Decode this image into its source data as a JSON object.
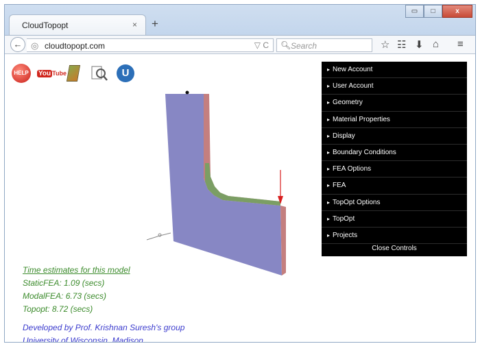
{
  "browser": {
    "tab_title": "CloudTopopt",
    "tab_close": "×",
    "new_tab": "+",
    "url": "cloudtopopt.com",
    "search_placeholder": "Search",
    "window_buttons": [
      "▭",
      "□",
      "x"
    ]
  },
  "toolbar_icons": [
    "help-icon",
    "youtube-icon",
    "book-icon",
    "magnifier-icon",
    "u-icon"
  ],
  "help_text": "HELP",
  "youtube_text": "You",
  "youtube_tube": "Tube",
  "u_text": "U",
  "menu": {
    "items": [
      "New Account",
      "User Account",
      "Geometry",
      "Material Properties",
      "Display",
      "Boundary Conditions",
      "FEA Options",
      "FEA",
      "TopOpt Options",
      "TopOpt",
      "Projects"
    ],
    "close_label": "Close Controls"
  },
  "estimates": {
    "heading": "Time estimates for this model",
    "static": "StaticFEA: 1.09 (secs)",
    "modal": "ModalFEA: 6.73 (secs)",
    "topopt": "Topopt: 8.72 (secs)"
  },
  "credits": {
    "line1": "Developed by Prof. Krishnan Suresh's group",
    "line2": "University of Wisconsin, Madison"
  },
  "colors": {
    "part_face": "#8787c4",
    "part_side": "#c47f7f",
    "part_edge": "#6fa35f",
    "load_arrow": "#d81f1f",
    "text_green": "#3a8a2a",
    "text_blue": "#3a3acd"
  }
}
